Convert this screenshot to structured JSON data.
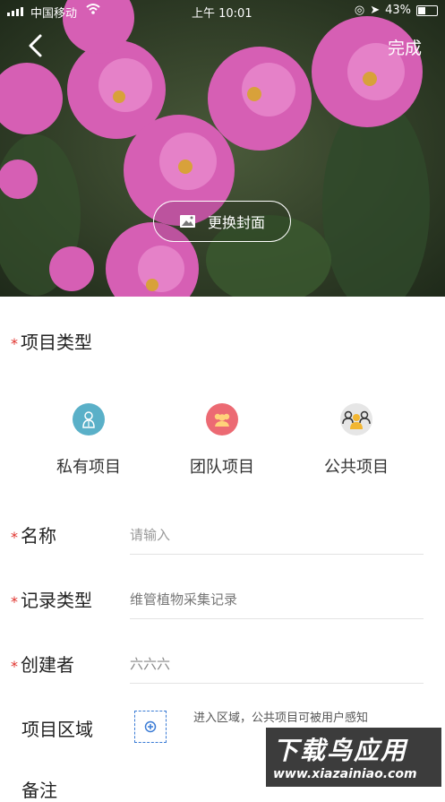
{
  "status_bar": {
    "carrier": "中国移动",
    "time": "上午 10:01",
    "battery": "43%"
  },
  "header": {
    "back_icon": "chevron-left-icon",
    "done_label": "完成"
  },
  "cover": {
    "change_label": "更换封面",
    "change_icon": "image-icon"
  },
  "project_type": {
    "title": "项目类型",
    "required_mark": "*",
    "options": [
      {
        "label": "私有项目",
        "icon": "private-user-icon",
        "color": "#5ab0c8"
      },
      {
        "label": "团队项目",
        "icon": "team-icon",
        "color": "#ec6a73"
      },
      {
        "label": "公共项目",
        "icon": "public-group-icon",
        "color": "#e6e6e6"
      }
    ]
  },
  "form": {
    "name": {
      "label": "名称",
      "required_mark": "*",
      "placeholder": "请输入"
    },
    "record_type": {
      "label": "记录类型",
      "required_mark": "*",
      "value": "维管植物采集记录"
    },
    "creator": {
      "label": "创建者",
      "required_mark": "*",
      "value": "六六六"
    },
    "area": {
      "label": "项目区域",
      "hint": "进入区域，公共项目可被用户感知",
      "button_icon": "add-location-icon"
    },
    "notes": {
      "label": "备注"
    }
  },
  "watermark": {
    "main": "下载鸟应用",
    "url": "www.xiazainiao.com"
  }
}
